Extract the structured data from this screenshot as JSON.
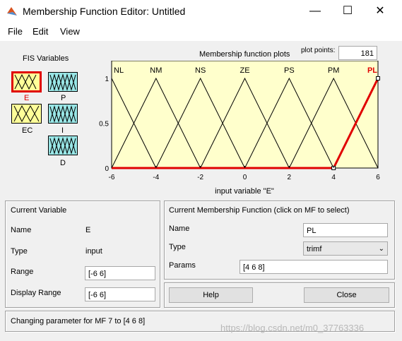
{
  "window": {
    "title": "Membership Function Editor: Untitled",
    "minimize": "—",
    "maximize": "☐",
    "close": "✕"
  },
  "menu": [
    "File",
    "Edit",
    "View"
  ],
  "fis": {
    "heading": "FIS Variables",
    "variables": [
      {
        "name": "E",
        "kind": "input",
        "selected": true
      },
      {
        "name": "P",
        "kind": "output",
        "selected": false
      },
      {
        "name": "EC",
        "kind": "input",
        "selected": false
      },
      {
        "name": "I",
        "kind": "output",
        "selected": false
      },
      {
        "name": "D",
        "kind": "output",
        "selected": false
      }
    ]
  },
  "plot": {
    "title": "Membership function plots",
    "plot_points_label": "plot points:",
    "plot_points_value": "181",
    "xlabel": "input variable \"E\"",
    "x_ticks": [
      "-6",
      "-4",
      "-2",
      "0",
      "2",
      "4",
      "6"
    ],
    "y_ticks": [
      "0",
      "0.5",
      "1"
    ],
    "mf_labels": [
      "NL",
      "NM",
      "NS",
      "ZE",
      "PS",
      "PM",
      "PL"
    ],
    "selected_mf": "PL",
    "colors": {
      "background": "#ffffcc",
      "selected": "#e00000",
      "normal": "#000000"
    }
  },
  "chart_data": {
    "type": "line",
    "title": "Membership function plots",
    "xlabel": "input variable \"E\"",
    "ylabel": "",
    "xlim": [
      -6,
      6
    ],
    "ylim": [
      0,
      1
    ],
    "series": [
      {
        "name": "NL",
        "params": [
          -8,
          -6,
          -4
        ]
      },
      {
        "name": "NM",
        "params": [
          -6,
          -4,
          -2
        ]
      },
      {
        "name": "NS",
        "params": [
          -4,
          -2,
          0
        ]
      },
      {
        "name": "ZE",
        "params": [
          -2,
          0,
          2
        ]
      },
      {
        "name": "PS",
        "params": [
          0,
          2,
          4
        ]
      },
      {
        "name": "PM",
        "params": [
          2,
          4,
          6
        ]
      },
      {
        "name": "PL",
        "params": [
          4,
          6,
          8
        ]
      }
    ]
  },
  "current_variable": {
    "heading": "Current Variable",
    "name_label": "Name",
    "name_value": "E",
    "type_label": "Type",
    "type_value": "input",
    "range_label": "Range",
    "range_value": "[-6 6]",
    "display_range_label": "Display Range",
    "display_range_value": "[-6 6]"
  },
  "current_mf": {
    "heading": "Current Membership Function (click on MF to select)",
    "name_label": "Name",
    "name_value": "PL",
    "type_label": "Type",
    "type_value": "trimf",
    "params_label": "Params",
    "params_value": "[4 6 8]"
  },
  "buttons": {
    "help": "Help",
    "close": "Close"
  },
  "status": "Changing parameter for MF 7 to  [4 6 8]",
  "watermark": "https://blog.csdn.net/m0_37763336"
}
